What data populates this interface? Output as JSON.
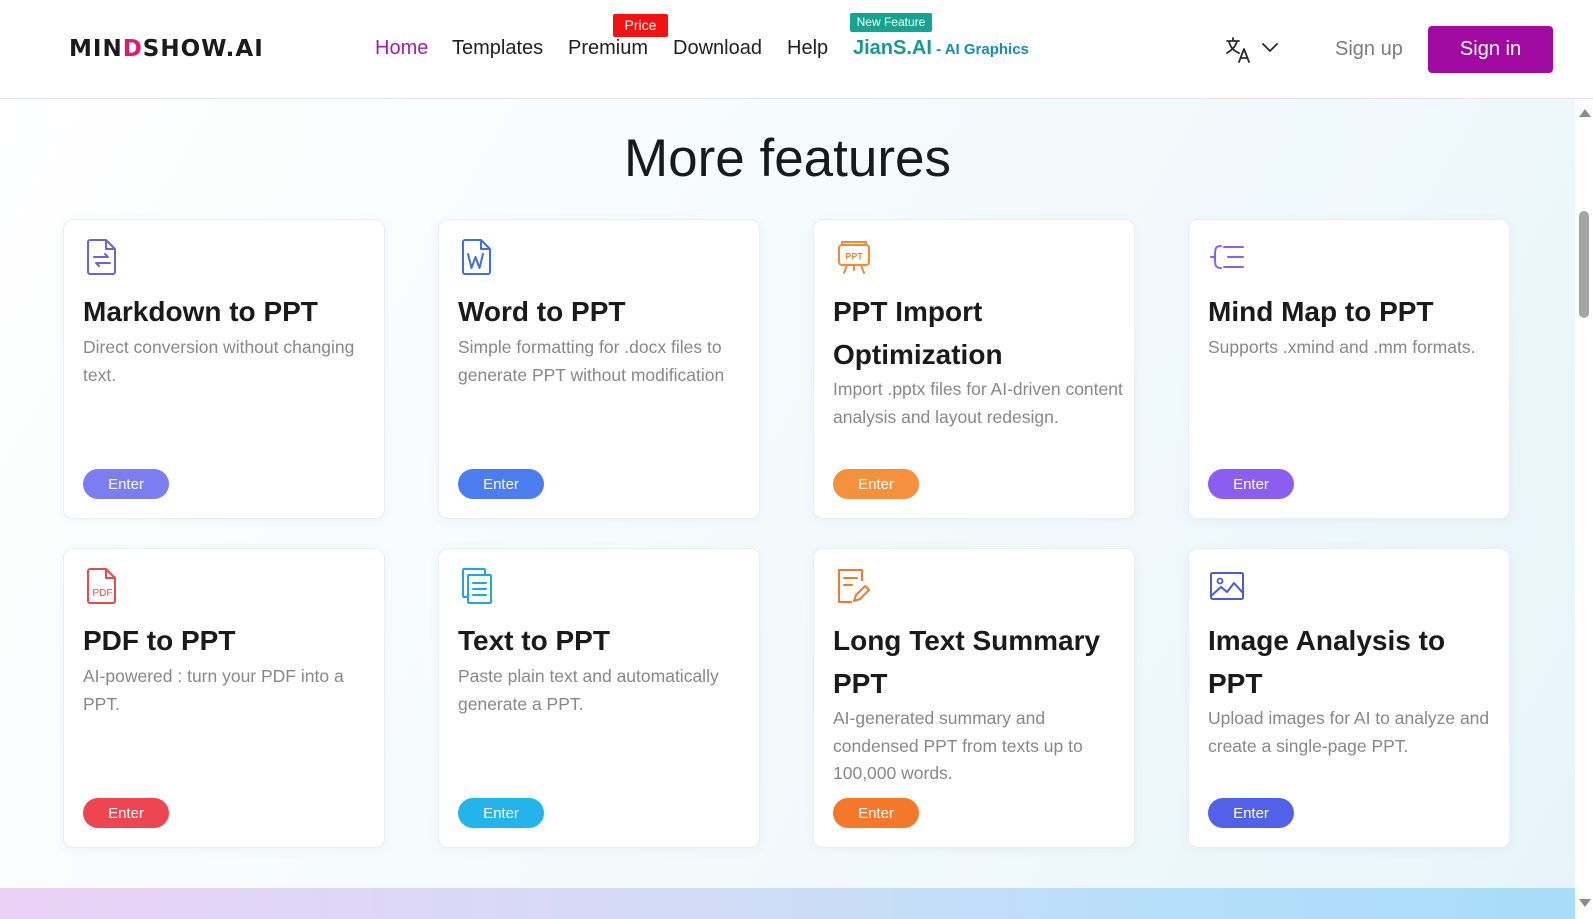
{
  "header": {
    "logo_prefix": "MIN",
    "logo_accent": "D",
    "logo_suffix": "SHOW.AI",
    "nav": [
      {
        "label": "Home",
        "active": true
      },
      {
        "label": "Templates"
      },
      {
        "label": "Premium"
      },
      {
        "label": "Download"
      },
      {
        "label": "Help"
      }
    ],
    "price_badge": "Price",
    "new_feature_badge": "New Feature",
    "jians_label": "JianS.AI",
    "jians_sub": " - AI Graphics",
    "signup_label": "Sign up",
    "signin_label": "Sign in"
  },
  "section": {
    "title": "More features"
  },
  "cards": [
    {
      "title": "Markdown to PPT",
      "desc": "Direct conversion without changing text.",
      "button": "Enter",
      "color": "#7b7ef0",
      "icon": "markdown-file-icon"
    },
    {
      "title": "Word to PPT",
      "desc": "Simple formatting for .docx files to generate PPT without modification",
      "button": "Enter",
      "color": "#4b7cf0",
      "icon": "word-file-icon"
    },
    {
      "title": "PPT Import Optimization",
      "desc": "Import .pptx files for AI-driven content analysis and layout redesign.",
      "button": "Enter",
      "color": "#f5913c",
      "icon": "ppt-import-icon"
    },
    {
      "title": "Mind Map to PPT",
      "desc": "Supports .xmind and .mm formats.",
      "button": "Enter",
      "color": "#8b5df0",
      "icon": "mind-map-icon"
    },
    {
      "title": "PDF to PPT",
      "desc": "AI-powered : turn your PDF into a PPT.",
      "button": "Enter",
      "color": "#ee4650",
      "icon": "pdf-file-icon"
    },
    {
      "title": "Text to PPT",
      "desc": "Paste plain text and automatically generate a PPT.",
      "button": "Enter",
      "color": "#22b4ea",
      "icon": "text-file-icon"
    },
    {
      "title": "Long Text Summary PPT",
      "desc": "AI-generated summary and condensed PPT from texts up to 100,000 words.",
      "button": "Enter",
      "color": "#f5782a",
      "icon": "long-text-icon"
    },
    {
      "title": "Image Analysis to PPT",
      "desc": "Upload images for AI to analyze and create a single-page PPT.",
      "button": "Enter",
      "color": "#5162e8",
      "icon": "image-icon"
    }
  ]
}
